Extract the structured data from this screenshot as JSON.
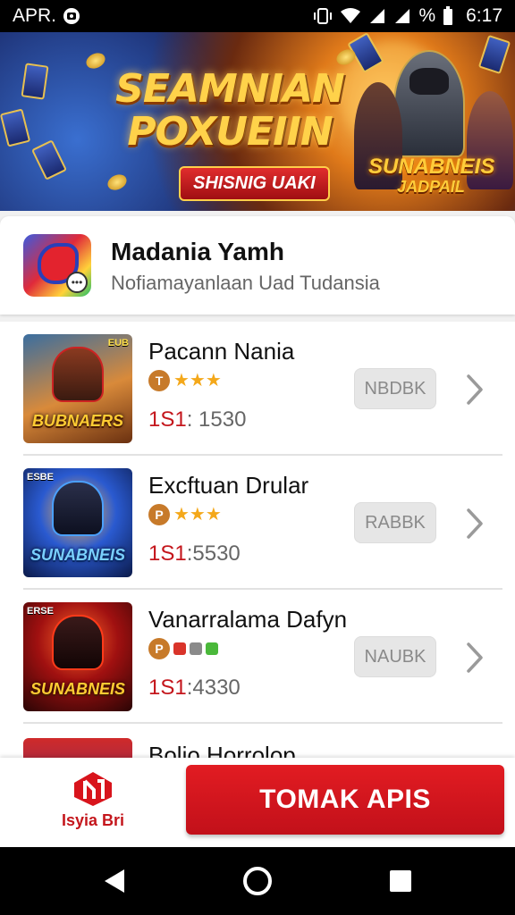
{
  "status_bar": {
    "carrier": "APR.",
    "battery": "%",
    "time": "6:17"
  },
  "banner": {
    "title_line1": "SEAMNIAN",
    "title_line2": "POXUEIIN",
    "subtitle": "SHISNIG UAKI",
    "logo_line1": "SUNABNEIS",
    "logo_line2": "JADPAIL"
  },
  "featured": {
    "title": "Madania Yamh",
    "subtitle": "Nofiamayanlaan Uad Tudansia"
  },
  "games": [
    {
      "name": "Pacann Nania",
      "badge": "T",
      "stars": "★★★",
      "price_prefix": "1S1",
      "price": ": 1530",
      "button": "NBDBK",
      "thumb_label": "BUBNAERS",
      "thumb_corner": "EUB"
    },
    {
      "name": "Excftuan Drular",
      "badge": "P",
      "stars": "★★★",
      "price_prefix": "1S1",
      "price": ":5530",
      "button": "RABBK",
      "thumb_label": "SUNABNEIS",
      "thumb_corner": "ESBE"
    },
    {
      "name": "Vanarralama Dafyn",
      "badge": "P",
      "stars": "",
      "price_prefix": "1S1",
      "price": ":4330",
      "button": "NAUBK",
      "thumb_label": "SUNABNEIS",
      "thumb_corner": "ERSE"
    },
    {
      "name": "Bolio Horrolop"
    }
  ],
  "bottom": {
    "brand_name": "Isyia Bri",
    "cta": "TOMAK APIS"
  },
  "colors": {
    "accent_red": "#c4161c",
    "star": "#f4a81a",
    "badge": "#c77a2a"
  }
}
